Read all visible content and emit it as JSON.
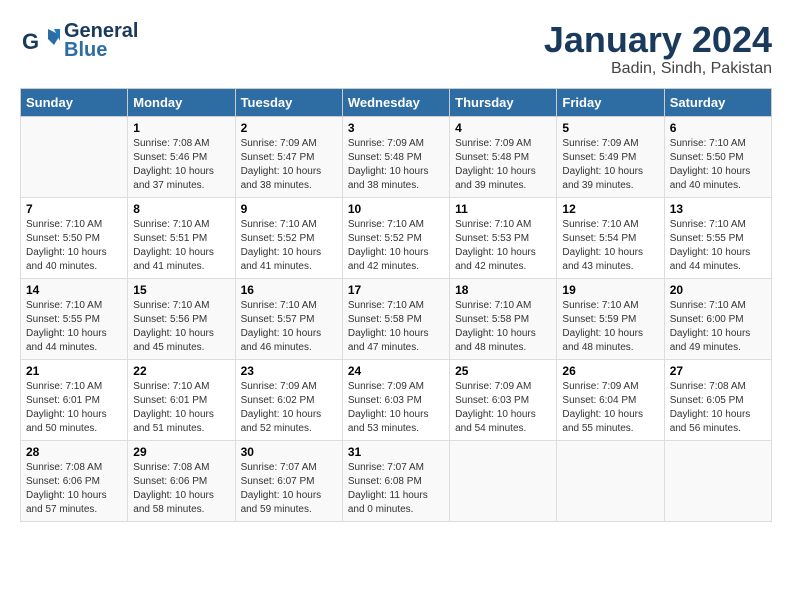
{
  "header": {
    "logo_line1": "General",
    "logo_line2": "Blue",
    "month_title": "January 2024",
    "location": "Badin, Sindh, Pakistan"
  },
  "days_of_week": [
    "Sunday",
    "Monday",
    "Tuesday",
    "Wednesday",
    "Thursday",
    "Friday",
    "Saturday"
  ],
  "weeks": [
    [
      {
        "day": "",
        "info": ""
      },
      {
        "day": "1",
        "info": "Sunrise: 7:08 AM\nSunset: 5:46 PM\nDaylight: 10 hours\nand 37 minutes."
      },
      {
        "day": "2",
        "info": "Sunrise: 7:09 AM\nSunset: 5:47 PM\nDaylight: 10 hours\nand 38 minutes."
      },
      {
        "day": "3",
        "info": "Sunrise: 7:09 AM\nSunset: 5:48 PM\nDaylight: 10 hours\nand 38 minutes."
      },
      {
        "day": "4",
        "info": "Sunrise: 7:09 AM\nSunset: 5:48 PM\nDaylight: 10 hours\nand 39 minutes."
      },
      {
        "day": "5",
        "info": "Sunrise: 7:09 AM\nSunset: 5:49 PM\nDaylight: 10 hours\nand 39 minutes."
      },
      {
        "day": "6",
        "info": "Sunrise: 7:10 AM\nSunset: 5:50 PM\nDaylight: 10 hours\nand 40 minutes."
      }
    ],
    [
      {
        "day": "7",
        "info": "Sunrise: 7:10 AM\nSunset: 5:50 PM\nDaylight: 10 hours\nand 40 minutes."
      },
      {
        "day": "8",
        "info": "Sunrise: 7:10 AM\nSunset: 5:51 PM\nDaylight: 10 hours\nand 41 minutes."
      },
      {
        "day": "9",
        "info": "Sunrise: 7:10 AM\nSunset: 5:52 PM\nDaylight: 10 hours\nand 41 minutes."
      },
      {
        "day": "10",
        "info": "Sunrise: 7:10 AM\nSunset: 5:52 PM\nDaylight: 10 hours\nand 42 minutes."
      },
      {
        "day": "11",
        "info": "Sunrise: 7:10 AM\nSunset: 5:53 PM\nDaylight: 10 hours\nand 42 minutes."
      },
      {
        "day": "12",
        "info": "Sunrise: 7:10 AM\nSunset: 5:54 PM\nDaylight: 10 hours\nand 43 minutes."
      },
      {
        "day": "13",
        "info": "Sunrise: 7:10 AM\nSunset: 5:55 PM\nDaylight: 10 hours\nand 44 minutes."
      }
    ],
    [
      {
        "day": "14",
        "info": "Sunrise: 7:10 AM\nSunset: 5:55 PM\nDaylight: 10 hours\nand 44 minutes."
      },
      {
        "day": "15",
        "info": "Sunrise: 7:10 AM\nSunset: 5:56 PM\nDaylight: 10 hours\nand 45 minutes."
      },
      {
        "day": "16",
        "info": "Sunrise: 7:10 AM\nSunset: 5:57 PM\nDaylight: 10 hours\nand 46 minutes."
      },
      {
        "day": "17",
        "info": "Sunrise: 7:10 AM\nSunset: 5:58 PM\nDaylight: 10 hours\nand 47 minutes."
      },
      {
        "day": "18",
        "info": "Sunrise: 7:10 AM\nSunset: 5:58 PM\nDaylight: 10 hours\nand 48 minutes."
      },
      {
        "day": "19",
        "info": "Sunrise: 7:10 AM\nSunset: 5:59 PM\nDaylight: 10 hours\nand 48 minutes."
      },
      {
        "day": "20",
        "info": "Sunrise: 7:10 AM\nSunset: 6:00 PM\nDaylight: 10 hours\nand 49 minutes."
      }
    ],
    [
      {
        "day": "21",
        "info": "Sunrise: 7:10 AM\nSunset: 6:01 PM\nDaylight: 10 hours\nand 50 minutes."
      },
      {
        "day": "22",
        "info": "Sunrise: 7:10 AM\nSunset: 6:01 PM\nDaylight: 10 hours\nand 51 minutes."
      },
      {
        "day": "23",
        "info": "Sunrise: 7:09 AM\nSunset: 6:02 PM\nDaylight: 10 hours\nand 52 minutes."
      },
      {
        "day": "24",
        "info": "Sunrise: 7:09 AM\nSunset: 6:03 PM\nDaylight: 10 hours\nand 53 minutes."
      },
      {
        "day": "25",
        "info": "Sunrise: 7:09 AM\nSunset: 6:03 PM\nDaylight: 10 hours\nand 54 minutes."
      },
      {
        "day": "26",
        "info": "Sunrise: 7:09 AM\nSunset: 6:04 PM\nDaylight: 10 hours\nand 55 minutes."
      },
      {
        "day": "27",
        "info": "Sunrise: 7:08 AM\nSunset: 6:05 PM\nDaylight: 10 hours\nand 56 minutes."
      }
    ],
    [
      {
        "day": "28",
        "info": "Sunrise: 7:08 AM\nSunset: 6:06 PM\nDaylight: 10 hours\nand 57 minutes."
      },
      {
        "day": "29",
        "info": "Sunrise: 7:08 AM\nSunset: 6:06 PM\nDaylight: 10 hours\nand 58 minutes."
      },
      {
        "day": "30",
        "info": "Sunrise: 7:07 AM\nSunset: 6:07 PM\nDaylight: 10 hours\nand 59 minutes."
      },
      {
        "day": "31",
        "info": "Sunrise: 7:07 AM\nSunset: 6:08 PM\nDaylight: 11 hours\nand 0 minutes."
      },
      {
        "day": "",
        "info": ""
      },
      {
        "day": "",
        "info": ""
      },
      {
        "day": "",
        "info": ""
      }
    ]
  ]
}
